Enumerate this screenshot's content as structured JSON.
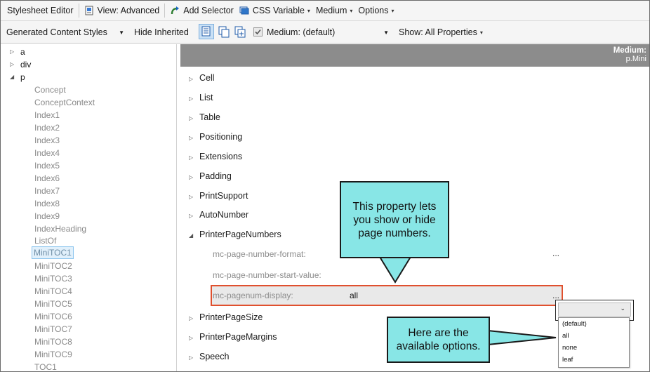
{
  "toolbar1": {
    "title": "Stylesheet Editor",
    "view": "View: Advanced",
    "add_selector": "Add Selector",
    "css_variable": "CSS Variable",
    "medium": "Medium",
    "options": "Options"
  },
  "toolbar2": {
    "styles_select": "Generated Content Styles",
    "hide_inherited": "Hide Inherited",
    "medium_select": "Medium: (default)",
    "show_select": "Show: All Properties"
  },
  "tree": {
    "top_items": [
      "a",
      "div",
      "p"
    ],
    "children": [
      "Concept",
      "ConceptContext",
      "Index1",
      "Index2",
      "Index3",
      "Index4",
      "Index5",
      "Index6",
      "Index7",
      "Index8",
      "Index9",
      "IndexHeading",
      "ListOf",
      "MiniTOC1",
      "MiniTOC2",
      "MiniTOC3",
      "MiniTOC4",
      "MiniTOC5",
      "MiniTOC6",
      "MiniTOC7",
      "MiniTOC8",
      "MiniTOC9",
      "TOC1"
    ],
    "selected": "MiniTOC1"
  },
  "panel_header": {
    "line1": "Medium:",
    "line2": "p.Mini"
  },
  "groups": [
    "Cell",
    "List",
    "Table",
    "Positioning",
    "Extensions",
    "Padding",
    "PrintSupport",
    "AutoNumber",
    "PrinterPageNumbers",
    "PrinterPageSize",
    "PrinterPageMargins",
    "Speech"
  ],
  "properties": [
    {
      "name": "mc-page-number-format:",
      "value": ""
    },
    {
      "name": "mc-page-number-start-value:",
      "value": ""
    },
    {
      "name": "mc-pagenum-display:",
      "value": "all"
    }
  ],
  "ellipsis": "...",
  "dropdown": {
    "options": [
      "(default)",
      "all",
      "none",
      "leaf"
    ]
  },
  "callouts": {
    "top": [
      "This property lets",
      "you show or hide",
      "page numbers."
    ],
    "bottom": [
      "Here are the",
      "available options."
    ]
  },
  "colors": {
    "callout_fill": "#88e6e6",
    "highlight_border": "#e0502e",
    "header_gray": "#8c8c8c"
  }
}
